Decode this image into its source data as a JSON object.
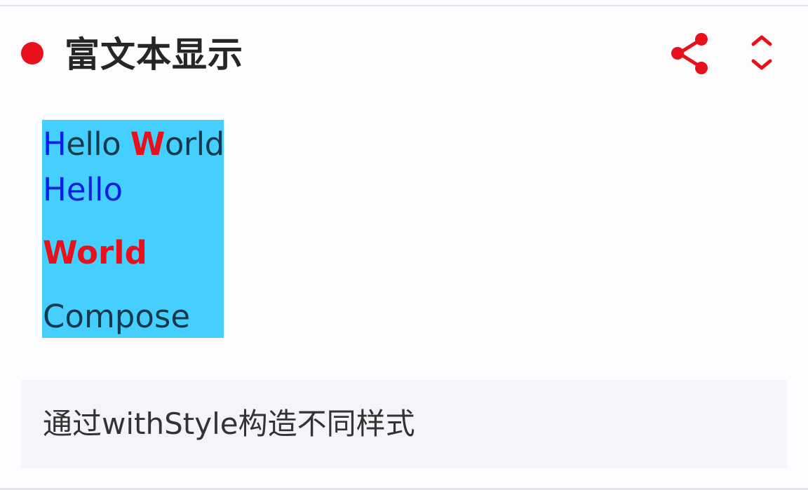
{
  "colors": {
    "accent": "#e8111b",
    "demo_background": "#45cfff",
    "hello_color": "#0a1ee6",
    "world_color": "#e8111b",
    "text_dark": "#15394c"
  },
  "header": {
    "title": "富文本显示",
    "bullet_icon": "red-dot-icon",
    "share_icon": "share-icon",
    "expand_icon": "expand-collapse-icon"
  },
  "demo": {
    "line1": {
      "h": "H",
      "ello": "ello ",
      "w": "W",
      "orld": "orld"
    },
    "line2": "Hello",
    "line3": "World",
    "line4": "Compose"
  },
  "description": {
    "text": "通过withStyle构造不同样式"
  }
}
